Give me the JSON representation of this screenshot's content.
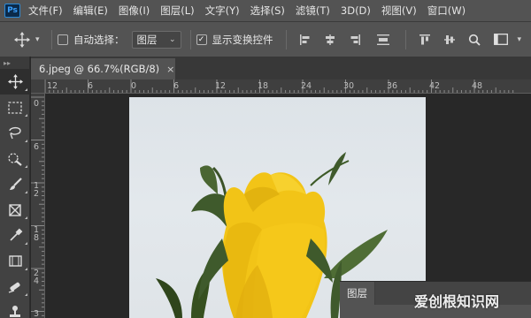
{
  "app": {
    "logo": "Ps"
  },
  "menu": [
    "文件(F)",
    "编辑(E)",
    "图像(I)",
    "图层(L)",
    "文字(Y)",
    "选择(S)",
    "滤镜(T)",
    "3D(D)",
    "视图(V)",
    "窗口(W)"
  ],
  "options": {
    "auto_select_label": "自动选择：",
    "auto_select_checked": false,
    "auto_select_target": "图层",
    "show_transform_label": "显示变换控件",
    "show_transform_checked": true
  },
  "toolbar": {
    "tools": [
      "move-tool",
      "marquee-tool",
      "lasso-tool",
      "quick-selection-tool",
      "brush-tool",
      "crop-tool",
      "eyedropper-tool",
      "frame-tool",
      "healing-brush-tool",
      "clone-stamp-tool"
    ]
  },
  "document": {
    "tab_label": "6.jpeg @ 66.7%(RGB/8)",
    "close_glyph": "×"
  },
  "ruler_top": [
    "12",
    "6",
    "0",
    "6",
    "12",
    "18",
    "24",
    "30",
    "36",
    "42",
    "48"
  ],
  "ruler_left": [
    "0",
    "6",
    "1 2",
    "1 8",
    "2 4",
    "3"
  ],
  "layers_panel": {
    "tab_label": "图层"
  },
  "watermark": "爱创根知识网",
  "colors": {
    "menubar": "#535353",
    "workspace": "#282828",
    "rose": "#f2c417",
    "leaf": "#3f5a2c",
    "accent": "#2b8ad8"
  }
}
